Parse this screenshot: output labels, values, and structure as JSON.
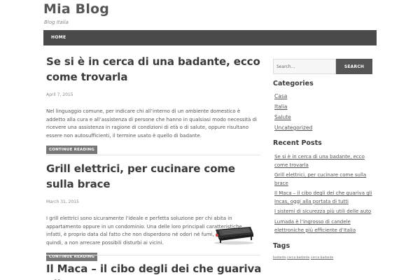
{
  "site": {
    "title": "Mia Blog",
    "description": "Blog Italia"
  },
  "nav": {
    "items": [
      {
        "label": "HOME"
      }
    ]
  },
  "posts": [
    {
      "title": "Se si è in cerca di una badante, ecco come trovarla",
      "date": "April 7, 2015",
      "excerpt": "Nel linguaggio comune, per indicare chi all’interno di un ambiente domestico è addetto alla cura e all’assistenza di persone che hanno in qualsiasi modo necessità di ricevere una assistenza in ragione di condizioni di età o di salute, oppure risultano essere non autosufficienti, il termine usato è quello di badante.",
      "read_more": "CONTINUE READING"
    },
    {
      "title": "Grill elettrici, per cucinare come sulla brace",
      "date": "March 31, 2015",
      "excerpt": "I grill elettrici sono sicuramente l’ideale e perfetta soluzione per chi abita in appartamento oppure in un condominio. Una delle loro principali caratteristiche, infatti, è proprio data dal fatto che non disperdono né odori né fumi, contribuendo, quindi, a non arrecare possibili disturbi ai vicini.",
      "read_more": "CONTINUE READING"
    },
    {
      "title": "Il Maca – il cibo degli dei che guariva gli"
    }
  ],
  "sidebar": {
    "search": {
      "placeholder": "Search...",
      "button": "SEARCH"
    },
    "categories": {
      "title": "Categories",
      "items": [
        "Casa",
        "Italia",
        "Salute",
        "Uncategorized"
      ]
    },
    "recent_posts": {
      "title": "Recent Posts",
      "items": [
        "Se si è in cerca di una badante, ecco come trovarla",
        "Grill elettrici, per cucinare come sulla brace",
        "Il Maca – il cibo degli dei che guariva gli Incas, oggi alla portata di tutti",
        "I sistemi di sicurezza più utili delle auto",
        "Lumada è l’ingrosso di candele elettroniche più efficiente d’Italia"
      ]
    },
    "tags": {
      "title": "Tags",
      "items": [
        "badante",
        "cerca badante",
        "cerca badante"
      ]
    }
  },
  "colors": {
    "nav_bg": "#4a4a4a",
    "button_bg": "#777777",
    "search_button_bg": "#555555"
  }
}
